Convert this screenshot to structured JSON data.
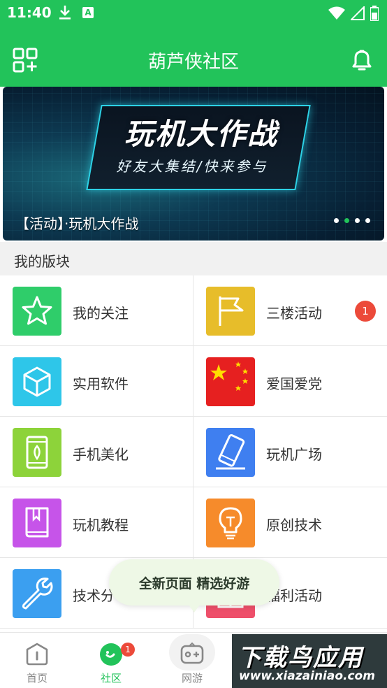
{
  "status_bar": {
    "time": "11:40",
    "download_icon": "download-icon",
    "app_icon": "A"
  },
  "header": {
    "title": "葫芦侠社区",
    "left_icon": "add-grid-icon",
    "right_icon": "bell-icon"
  },
  "banner": {
    "title": "玩机大作战",
    "subtitle": "好友大集结/快来参与",
    "caption": "【活动】·玩机大作战",
    "dot_count": 4,
    "active_dot": 1
  },
  "section": {
    "title": "我的版块"
  },
  "boards": [
    {
      "label": "我的关注",
      "icon": "star-icon",
      "color": "#2fcd6a"
    },
    {
      "label": "三楼活动",
      "icon": "flag-icon",
      "color": "#e7bd2a",
      "badge": "1"
    },
    {
      "label": "实用软件",
      "icon": "cube-icon",
      "color": "#2ec6e9"
    },
    {
      "label": "爱国爱党",
      "icon": "china-flag-icon",
      "color": "#e62020"
    },
    {
      "label": "手机美化",
      "icon": "phone-leaf-icon",
      "color": "#8dd33a"
    },
    {
      "label": "玩机广场",
      "icon": "phone-tilt-icon",
      "color": "#3f7ff0"
    },
    {
      "label": "玩机教程",
      "icon": "book-icon",
      "color": "#c654e9"
    },
    {
      "label": "原创技术",
      "icon": "bulb-icon",
      "color": "#f68b2b"
    },
    {
      "label": "技术分",
      "icon": "wrench-icon",
      "color": "#3b9ff0"
    },
    {
      "label": "福利活动",
      "icon": "gift-icon",
      "color": "#ee4f6a"
    }
  ],
  "toast": {
    "text": "全新页面  精选好游"
  },
  "bottom_nav": [
    {
      "label": "首页",
      "icon": "home-icon",
      "active": false
    },
    {
      "label": "社区",
      "icon": "community-icon",
      "active": true,
      "badge": "1"
    },
    {
      "label": "网游",
      "icon": "gamepad-icon",
      "active": false
    }
  ],
  "watermark": {
    "title": "下载鸟应用",
    "url": "www.xiazainiao.com"
  }
}
